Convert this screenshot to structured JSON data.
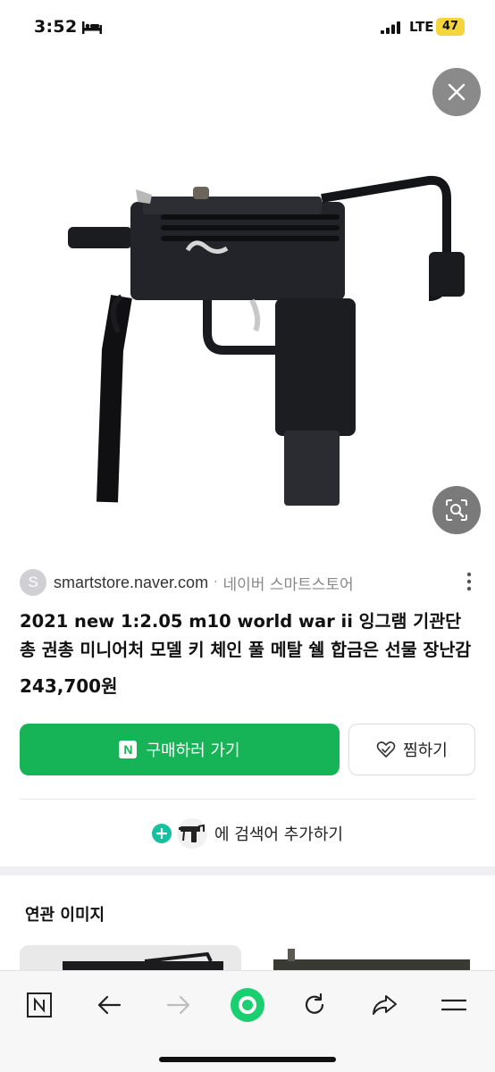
{
  "status_bar": {
    "time": "3:52",
    "network": "LTE",
    "battery": "47",
    "icons": [
      "bed-icon",
      "signal-icon"
    ]
  },
  "viewer": {
    "close_icon": "close-icon",
    "lens_icon": "image-search-icon"
  },
  "source": {
    "avatar_letter": "S",
    "domain": "smartstore.naver.com",
    "separator": "·",
    "site_name": "네이버 스마트스토어"
  },
  "product": {
    "title": "2021 new 1:2.05 m10 world war ii 잉그램 기관단총 권총 미니어처 모델 키 체인 풀 메탈 쉘 합금은 선물 장난감",
    "price": "243,700원"
  },
  "actions": {
    "buy_badge": "N",
    "buy_label": "구매하러 가기",
    "wish_label": "찜하기"
  },
  "add_search": {
    "label": "에 검색어 추가하기"
  },
  "related": {
    "title": "연관 이미지"
  },
  "toolbar": {
    "items": [
      "naver-n-icon",
      "back-arrow-icon",
      "forward-arrow-icon",
      "home-green-icon",
      "refresh-icon",
      "share-icon",
      "menu-icon"
    ],
    "naver_label": "N"
  },
  "colors": {
    "accent_green": "#17b357",
    "battery_yellow": "#f4d53c",
    "plus_teal": "#17c0a0"
  }
}
